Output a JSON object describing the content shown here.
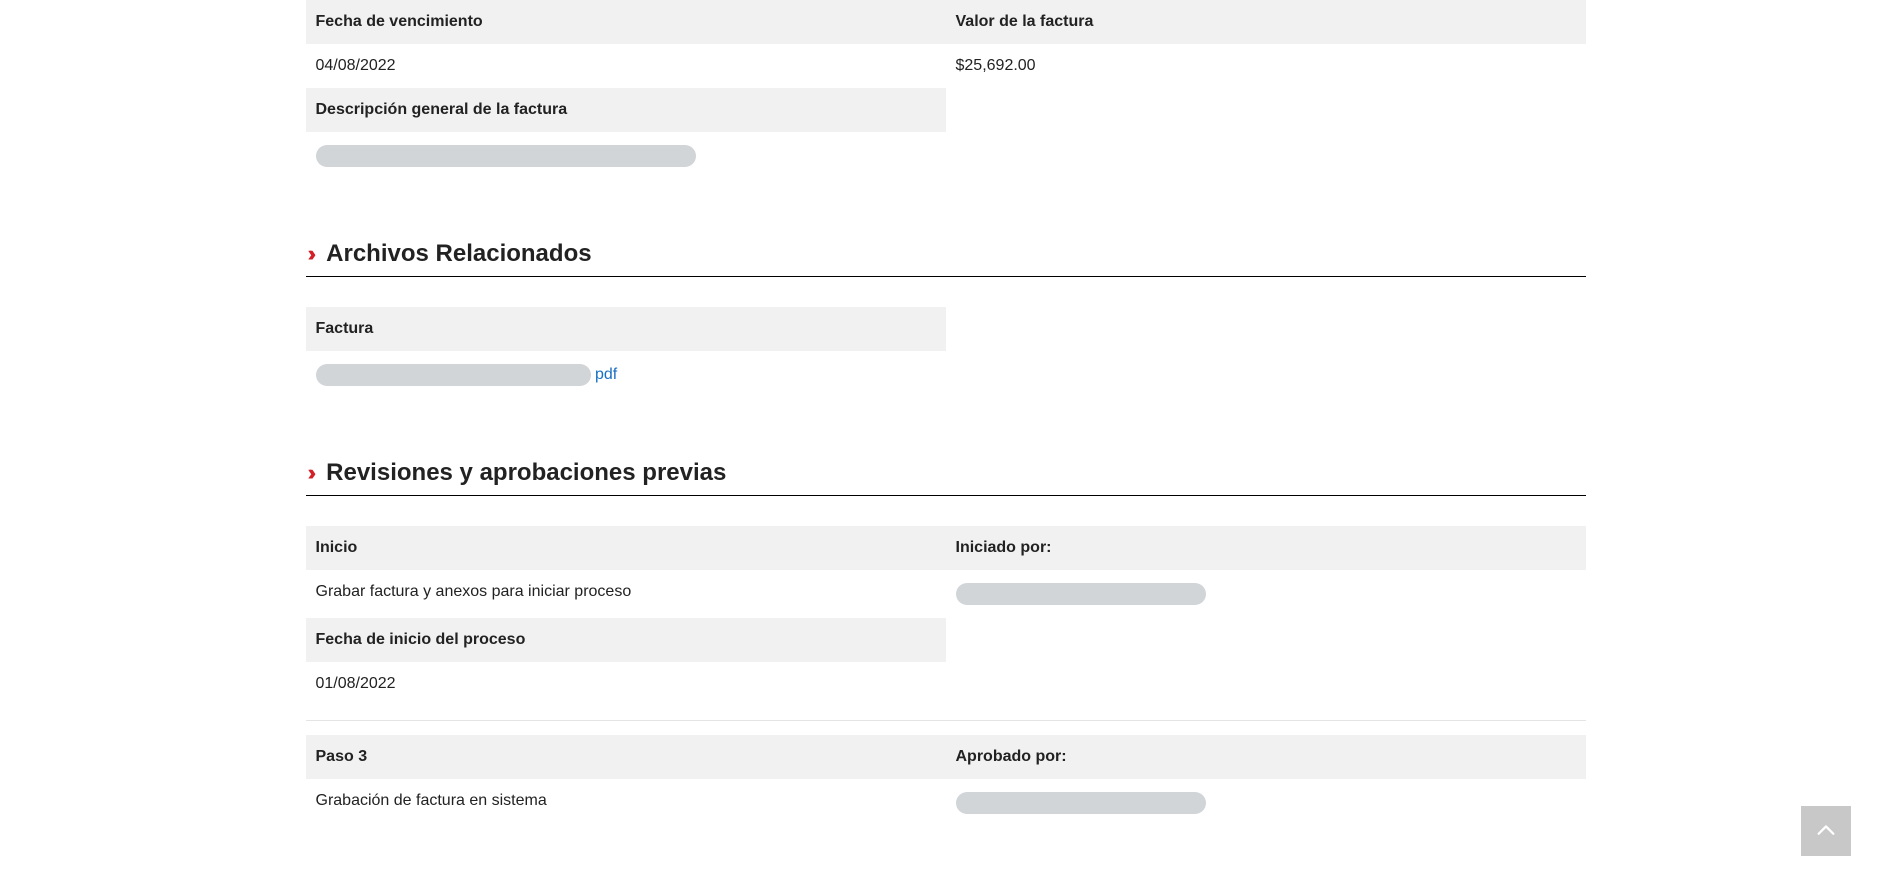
{
  "invoice": {
    "dueDate": {
      "label": "Fecha de vencimiento",
      "value": "04/08/2022"
    },
    "amount": {
      "label": "Valor de la factura",
      "value": "$25,692.00"
    },
    "description": {
      "label": "Descripción general de la factura"
    }
  },
  "sections": {
    "relatedFiles": "Archivos Relacionados",
    "reviews": "Revisiones y aprobaciones previas"
  },
  "files": {
    "invoiceLabel": "Factura",
    "ext": "pdf"
  },
  "reviews": {
    "start": {
      "stepLabel": "Inicio",
      "stepValue": "Grabar factura y anexos para iniciar proceso",
      "byLabel": "Iniciado por:",
      "dateLabel": "Fecha de inicio del proceso",
      "dateValue": "01/08/2022"
    },
    "step3": {
      "stepLabel": "Paso 3",
      "stepValue": "Grabación de factura en sistema",
      "byLabel": "Aprobado por:"
    }
  }
}
